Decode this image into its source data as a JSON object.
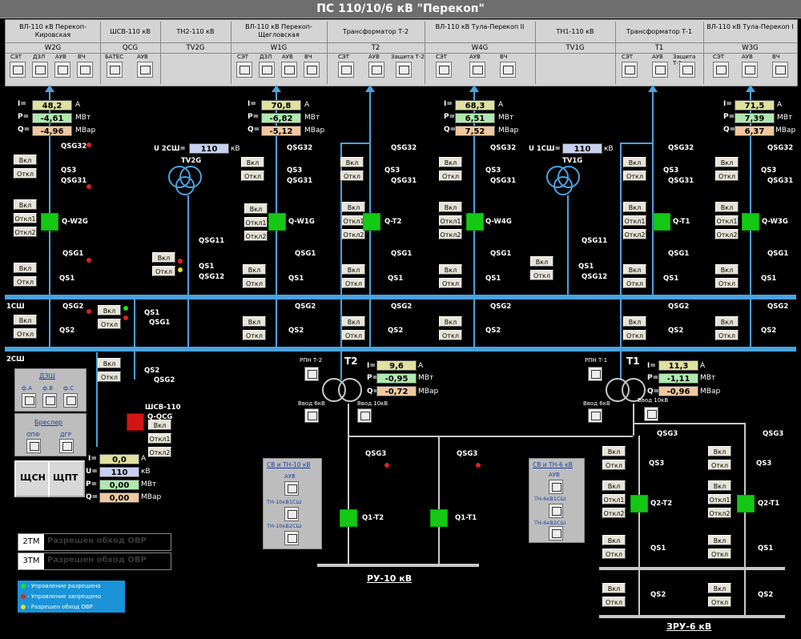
{
  "title": "ПС 110/10/6 кВ \"Перекоп\"",
  "top_panel": [
    {
      "title": "ВЛ-110 кВ Перекоп-Кировская",
      "code": "W2G",
      "labels": [
        "СЭТ",
        "ДЗЛ",
        "АУВ",
        "ВЧ"
      ]
    },
    {
      "title": "ШСВ-110 кВ",
      "code": "QCG",
      "labels": [
        "БАТЕС",
        "АУВ"
      ]
    },
    {
      "title": "ТН2-110 кВ",
      "code": "TV2G",
      "labels": []
    },
    {
      "title": "ВЛ-110 кВ Перекоп-Щегловская",
      "code": "W1G",
      "labels": [
        "СЭТ",
        "ДЗЛ",
        "АУВ",
        "ВЧ"
      ]
    },
    {
      "title": "Трансформатор Т-2",
      "code": "T2",
      "labels": [
        "СЭТ",
        "АУВ",
        "Защита Т-2"
      ]
    },
    {
      "title": "ВЛ-110 кВ Тула-Перекоп II",
      "code": "W4G",
      "labels": [
        "СЭТ",
        "АУВ",
        "ВЧ"
      ]
    },
    {
      "title": "ТН1-110 кВ",
      "code": "TV1G",
      "labels": []
    },
    {
      "title": "Трансформатор Т-1",
      "code": "T1",
      "labels": [
        "СЭТ",
        "АУВ",
        "Защита Т-1"
      ]
    },
    {
      "title": "ВЛ-110 кВ Тула-Перекоп I",
      "code": "W3G",
      "labels": [
        "СЭТ",
        "АУВ",
        "ВЧ"
      ]
    }
  ],
  "meas": {
    "w2g": {
      "I": "48,2",
      "P": "-4,61",
      "Q": "-4,96"
    },
    "w1g": {
      "I": "70,8",
      "P": "-6,82",
      "Q": "-5,12"
    },
    "w4g": {
      "I": "68,3",
      "P": "6,51",
      "Q": "7,52"
    },
    "w3g": {
      "I": "71,5",
      "P": "7,39",
      "Q": "6,37"
    },
    "t2": {
      "I": "9,6",
      "P": "-0,95",
      "Q": "-0,72"
    },
    "t1": {
      "I": "11,3",
      "P": "-1,11",
      "Q": "-0,96"
    },
    "qcg": {
      "I": "0,0",
      "U": "110",
      "P": "0,00",
      "Q": "0,00"
    },
    "u2sh": "110",
    "u1sh": "110"
  },
  "labels": {
    "I": "I=",
    "P": "P=",
    "Q": "Q=",
    "U": "U=",
    "A": "А",
    "MW": "МВт",
    "MVar": "МВар",
    "kV": "кВ",
    "u2sh": "U 2СШ=",
    "u1sh": "U 1СШ=",
    "on": "Вкл",
    "off": "Откл",
    "off1": "Откл1",
    "off2": "Откл2",
    "qsg32": "QSG32",
    "qs3": "QS3",
    "qsg31": "QSG31",
    "qsg1": "QSG1",
    "qs1": "QS1",
    "qsg2": "QSG2",
    "qs2": "QS2",
    "qsg11": "QSG11",
    "qsg12": "QSG12",
    "qsg3": "QSG3",
    "qw2g": "Q-W2G",
    "qw1g": "Q-W1G",
    "qt2": "Q-T2",
    "qw4g": "Q-W4G",
    "qt1": "Q-T1",
    "qw3g": "Q-W3G",
    "tv2g": "TV2G",
    "tv1g": "TV1G",
    "t2": "T2",
    "t1": "T1",
    "sh1": "1СШ",
    "sh2": "2СШ",
    "shsv": "ШСВ-110",
    "qcg": "Q-QCG",
    "rpn_t2": "РПН Т-2",
    "rpn_t1": "РПН Т-1",
    "vvod6": "Ввод 6кВ",
    "vvod10": "Ввод 10кВ",
    "dzsh": "ДЗШ",
    "fa": "ф.А",
    "fb": "ф.В",
    "fc": "ф.С",
    "bresler": "Бреслер",
    "opf": "ОПФ",
    "dgr": "ДГР",
    "shsn": "ЩСН",
    "shpt": "ЩПТ",
    "svtn10": "СВ и ТН-10 кВ",
    "svtn6": "СВ и ТН-6 кВ",
    "auv": "АУВ",
    "tn10_1": "ТН-10кВ1СШ",
    "tn10_2": "ТН-10кВ2СШ",
    "tn6_1": "ТН-6кВ1СШ",
    "tn6_2": "ТН-6кВ2СШ",
    "q1t2": "Q1-T2",
    "q1t1": "Q1-T1",
    "q2t2": "Q2-T2",
    "q2t1": "Q2-T1",
    "ru10": "РУ-10 кВ",
    "zru6": "ЗРУ-6 кВ",
    "tm2": "2ТМ",
    "tm3": "3ТМ",
    "bypass": "Разрешен обход ОВР"
  },
  "legend": [
    "- Управление разрешено",
    "- Управление запрещено",
    "- Разрешен обход ОВР"
  ],
  "colors": {
    "bus": "#4aa3df",
    "on": "#14c814",
    "off": "#d21414",
    "panel": "#d4d4d4"
  }
}
